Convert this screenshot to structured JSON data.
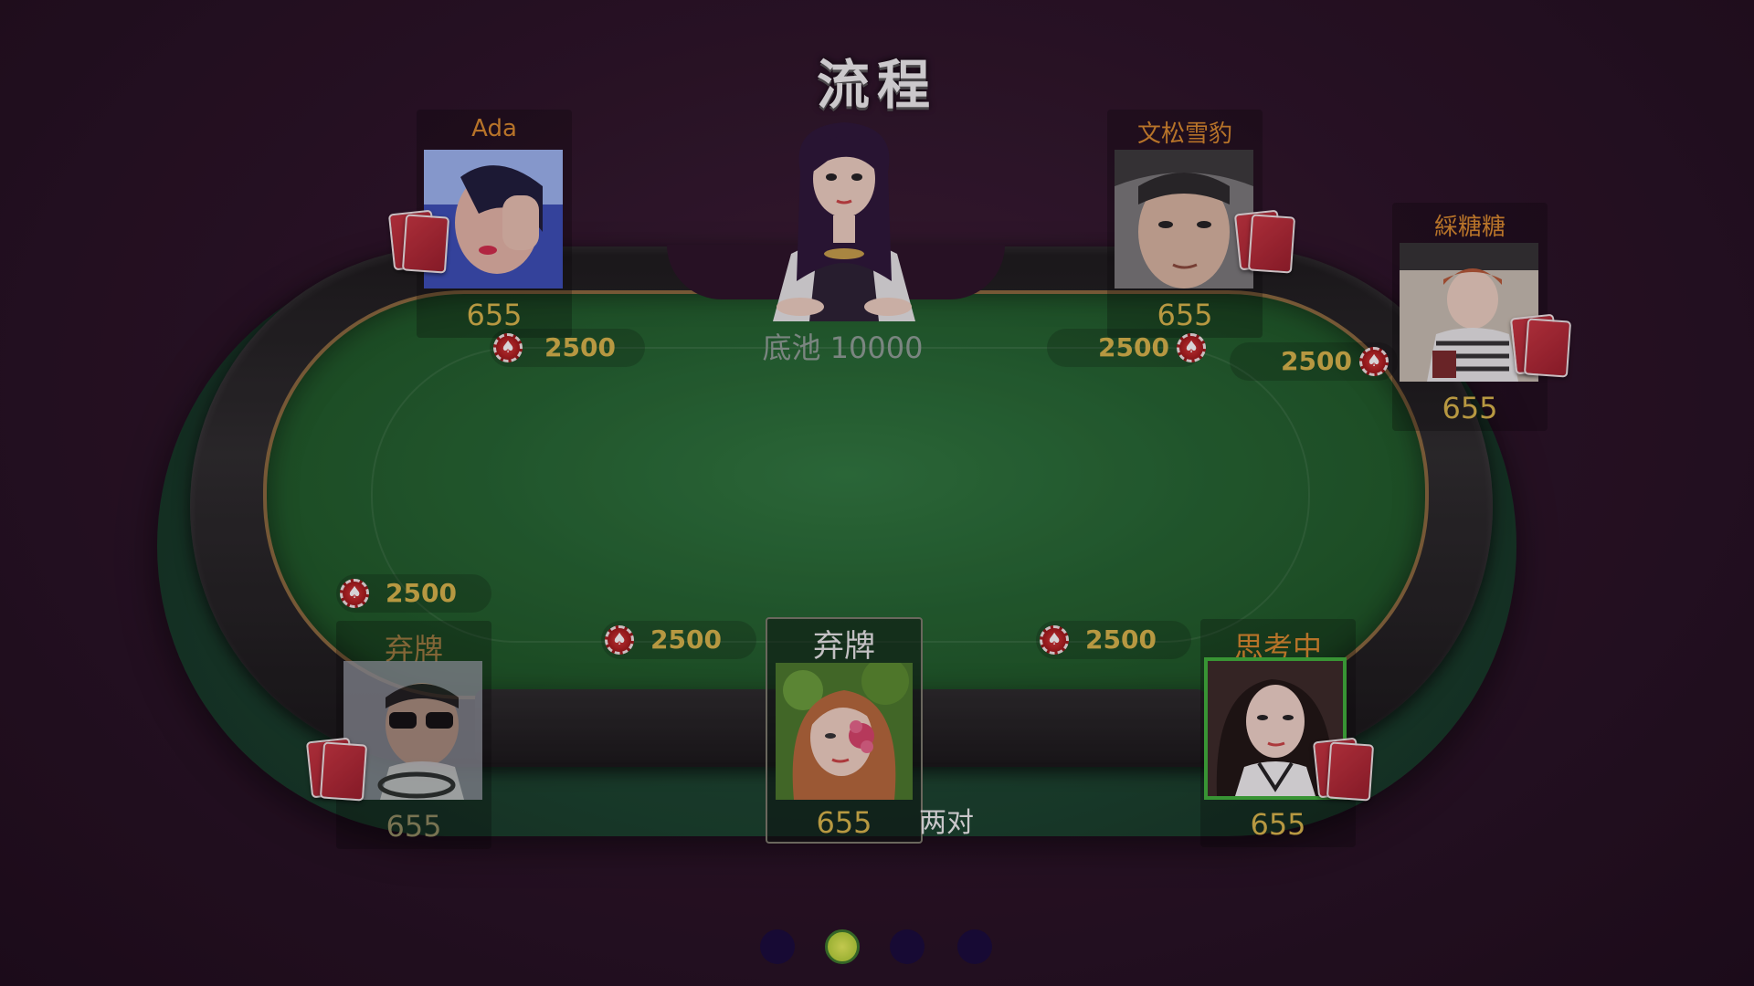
{
  "title": "流程",
  "pot": {
    "label": "底池 10000"
  },
  "players": {
    "top_left": {
      "name": "Ada",
      "chips": "655"
    },
    "top_right": {
      "name": "文松雪豹",
      "chips": "655"
    },
    "right": {
      "name": "綵糖糖",
      "chips": "655"
    },
    "bottom_left": {
      "name": "弃牌",
      "chips": "655"
    },
    "self": {
      "name": "弃牌",
      "chips": "655",
      "hand_rank": "两对"
    },
    "bottom_right": {
      "name": "思考中",
      "chips": "655"
    }
  },
  "bets": {
    "top_left": "2500",
    "top_right": "2500",
    "right": "2500",
    "bottom_left": "2500",
    "self_left": "2500",
    "self_right": "2500"
  },
  "pagination": {
    "total": 4,
    "active_index": 1
  },
  "colors": {
    "felt": "#22652f",
    "chip_red": "#b11e1e",
    "name_orange": "#d98a2c",
    "chips_gold": "#d9b84a",
    "active_dot": "#e7f25a",
    "thinking_border": "#3fb33a"
  }
}
